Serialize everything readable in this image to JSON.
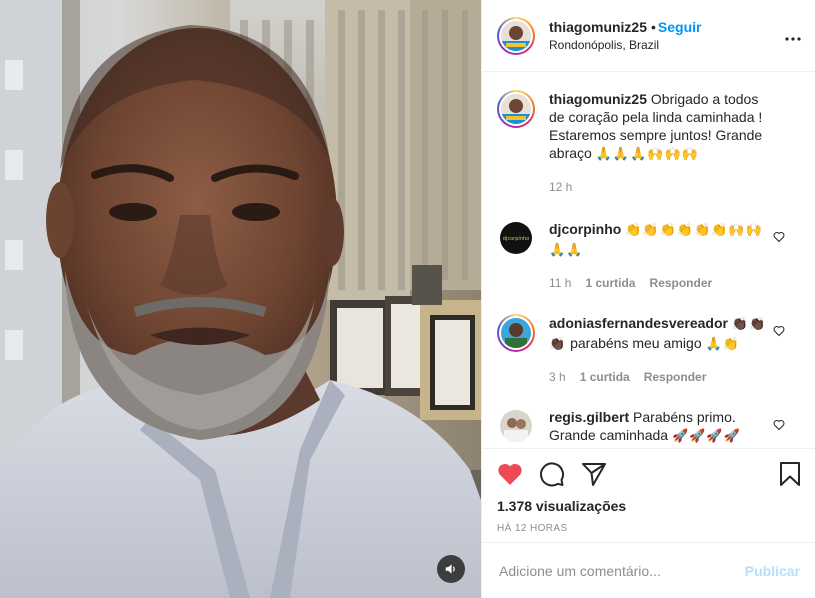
{
  "post": {
    "username": "thiagomuniz25",
    "follow_label": "Seguir",
    "separator": "•",
    "location": "Rondonópolis, Brazil",
    "more_icon": "more-options-icon"
  },
  "caption": {
    "username": "thiagomuniz25",
    "text": "Obrigado a todos de coração pela linda caminhada ! Estaremos sempre juntos! Grande abraço",
    "emojis": "🙏🙏🙏🙌🙌🙌",
    "time": "12 h"
  },
  "comments": [
    {
      "username": "djcorpinho",
      "text": "",
      "emojis": "👏👏👏👏👏👏🙌🙌🙏🙏",
      "time": "11 h",
      "likes": "1 curtida",
      "reply": "Responder",
      "avatar_text": "djcorpinho"
    },
    {
      "username": "adoniasfernandesvereador",
      "text": "parabéns meu amigo",
      "emojis_before": "👏🏿👏🏿👏🏿",
      "emojis_after": "🙏👏",
      "time": "3 h",
      "likes": "1 curtida",
      "reply": "Responder"
    },
    {
      "username": "regis.gilbert",
      "text": "Parabéns primo. Grande caminhada",
      "emojis": "🚀🚀🚀🚀"
    }
  ],
  "actions": {
    "liked": true,
    "views": "1.378 visualizações",
    "posted_ago": "HÁ 12 HORAS"
  },
  "composer": {
    "placeholder": "Adicione um comentário...",
    "publish_label": "Publicar"
  },
  "colors": {
    "accent": "#0095f6",
    "like": "#ed4956",
    "muted": "#8e8e8e",
    "publish_disabled": "#b2dffc"
  }
}
